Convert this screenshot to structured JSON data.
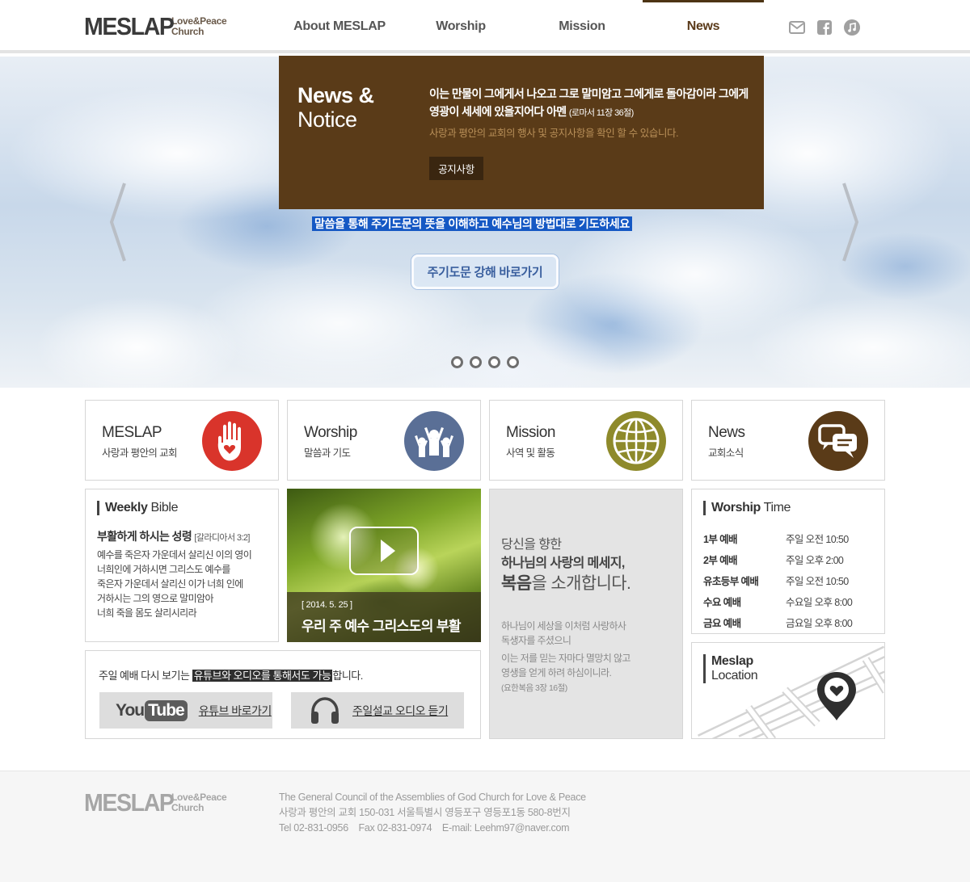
{
  "header": {
    "logo_text": "MESLAP",
    "logo_sub_1": "Love&Peace",
    "logo_sub_2": "Church",
    "nav": [
      "About MESLAP",
      "Worship",
      "Mission",
      "News"
    ],
    "active_nav": "News",
    "icons": [
      "mail-icon",
      "facebook-icon",
      "music-icon"
    ]
  },
  "dropdown": {
    "title_bold": "News &",
    "title_light": "Notice",
    "quote": "이는 만물이 그에게서 나오고 그로 말미암고 그에게로 돌아감이라 그에게 영광이 세세에 있을지어다 아멘",
    "quote_ref": "(로마서 11장 36절)",
    "description": "사랑과 평안의 교회의 행사 및 공지사항을 확인 할 수 있습니다.",
    "button": "공지사항"
  },
  "hero": {
    "highlight_text": "말씀을 통해 주기도문의 뜻을 이해하고 예수님의 방법대로 기도하세요",
    "button": "주기도문 강해 바로가기",
    "slide_count": 4
  },
  "categories": [
    {
      "title": "MESLAP",
      "subtitle": "사랑과 평안의 교회",
      "icon": "hand-heart-icon",
      "color": "#d9342b"
    },
    {
      "title": "Worship",
      "subtitle": "말씀과 기도",
      "icon": "worship-people-icon",
      "color": "#5a6f96"
    },
    {
      "title": "Mission",
      "subtitle": "사역 및 활동",
      "icon": "globe-icon",
      "color": "#8e8a2b"
    },
    {
      "title": "News",
      "subtitle": "교회소식",
      "icon": "chat-bubbles-icon",
      "color": "#5a3b18"
    }
  ],
  "weekly_bible": {
    "head_bold": "Weekly",
    "head_light": "Bible",
    "title": "부활하게 하시는 성령",
    "ref": "[갈라디아서 3:2]",
    "lines": [
      "예수를 죽은자 가운데서 살리신 이의 영이",
      "너희인에 거하시면 그리스도 예수를",
      "죽은자 가운데서 살리신 이가 너희 인에",
      "거하시는 그의 영으로 말미암아",
      "너희 죽을 몸도 살리시리라"
    ]
  },
  "video": {
    "date": "[ 2014. 5. 25 ]",
    "title": "우리 주 예수 그리스도의 부활"
  },
  "gospel": {
    "line1": "당신을 향한",
    "line2": "하나님의 사랑의 메세지,",
    "line3_bold": "복음",
    "line3_rest": "을 소개합니다.",
    "p1": [
      "하나님이 세상을 이처럼 사랑하사",
      "독생자를 주셨으니"
    ],
    "p2": [
      "이는 저를 믿는 자마다 멸망치 않고",
      "영생을 얻게 하려 하심이니라."
    ],
    "ref": "(요한복음 3장 16절)"
  },
  "worship_time": {
    "head_bold": "Worship",
    "head_light": "Time",
    "rows": [
      {
        "name": "1부 예배",
        "time": "주일 오전 10:50"
      },
      {
        "name": "2부 예배",
        "time": "주일 오후 2:00"
      },
      {
        "name": "유초등부 예배",
        "time": "주일 오전 10:50"
      },
      {
        "name": "수요 예배",
        "time": "수요일 오후 8:00"
      },
      {
        "name": "금요 예배",
        "time": "금요일 오후 8:00"
      }
    ]
  },
  "location": {
    "head_bold": "Meslap",
    "head_light": "Location"
  },
  "replay": {
    "text_before": "주일 예배 다시 보기는 ",
    "text_highlight": "유튜브와 오디오를 통해서도 가능",
    "text_after": "합니다.",
    "youtube_you": "You",
    "youtube_tube": "Tube",
    "youtube_label": "유튜브 바로가기",
    "audio_label": "주일설교 오디오 듣기"
  },
  "footer": {
    "logo_text": "MESLAP",
    "logo_sub_1": "Love&Peace",
    "logo_sub_2": "Church",
    "line1": "The General Council of the Assemblies of God Church for Love & Peace",
    "line2": "사랑과 평안의 교회 150-031 서울특별시 영등포구 영등포1동 580-8번지",
    "line3": "Tel 02-831-0956    Fax 02-831-0974    E-mail: Leehm97@naver.com"
  }
}
